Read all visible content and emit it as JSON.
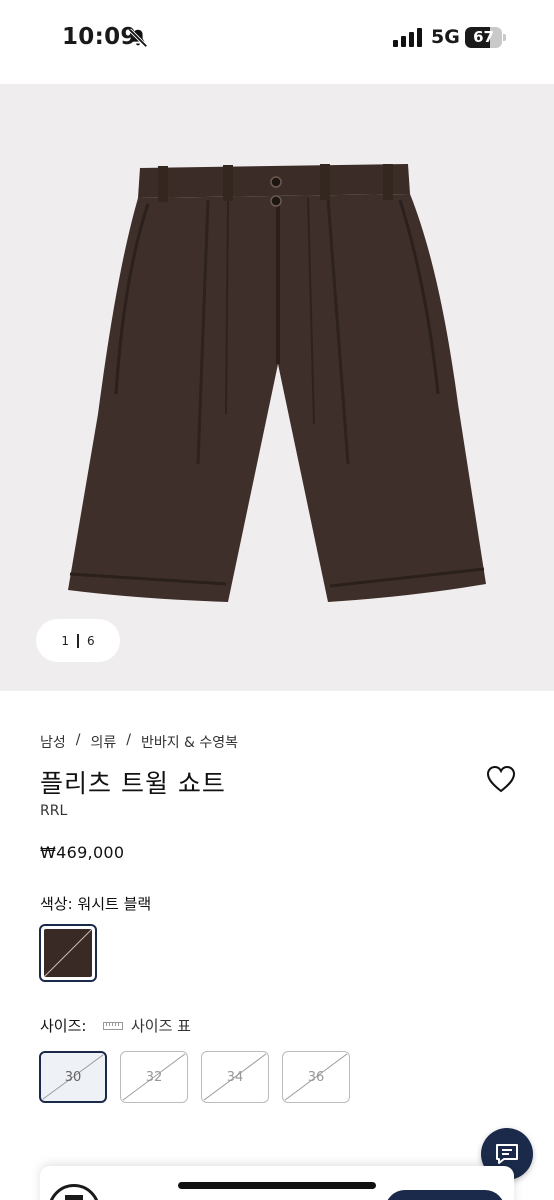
{
  "status_bar": {
    "time": "10:09",
    "network": "5G",
    "battery_percent": "67",
    "battery_level": 0.67,
    "icons": [
      "bell-off-icon",
      "signal-icon",
      "battery-icon"
    ]
  },
  "gallery": {
    "current": "1",
    "total": "6",
    "image_subject": "shorts-icon",
    "background": "#efeded"
  },
  "product": {
    "breadcrumb": [
      "남성",
      "의류",
      "반바지 & 수영복"
    ],
    "breadcrumb_separator": "/",
    "title": "플리츠 트윌 쇼트",
    "brand": "RRL",
    "price": "₩469,000",
    "color_label": "색상: 워시트 블랙",
    "swatch_color": "#3a2a26",
    "size_label": "사이즈:",
    "size_guide_label": "사이즈 표",
    "sizes": [
      {
        "label": "30",
        "selected": true,
        "sold_out": true
      },
      {
        "label": "32",
        "selected": false,
        "sold_out": true
      },
      {
        "label": "34",
        "selected": false,
        "sold_out": true
      },
      {
        "label": "36",
        "selected": false,
        "sold_out": true
      }
    ]
  },
  "colors": {
    "accent": "#1b2a4a",
    "text": "#1a1a1a"
  }
}
